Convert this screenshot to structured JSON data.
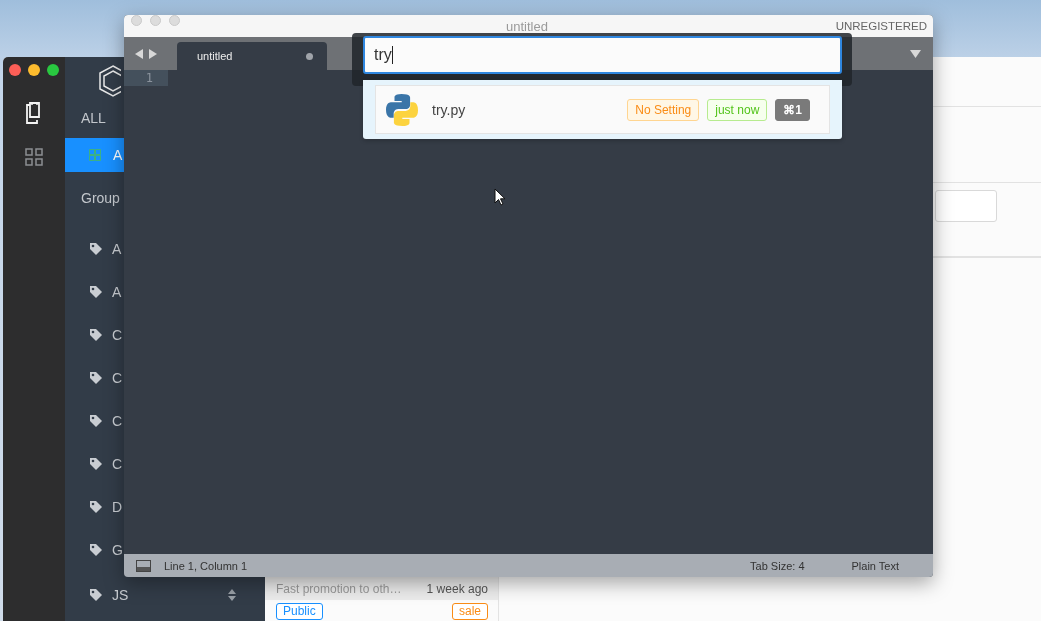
{
  "snippet_app": {
    "rail": [
      {
        "kind": "documents",
        "selected": true
      },
      {
        "kind": "grid",
        "selected": false
      }
    ],
    "sidebar": {
      "heading": "ALL",
      "all_item": {
        "label": "A",
        "selected": true
      },
      "group_heading": "Group",
      "tags": [
        {
          "label": "A"
        },
        {
          "label": "A"
        },
        {
          "label": "C"
        },
        {
          "label": "C"
        },
        {
          "label": "C"
        },
        {
          "label": "C"
        },
        {
          "label": "D"
        },
        {
          "label": "G"
        },
        {
          "label": "JS",
          "sortable": true
        }
      ]
    },
    "snippet": {
      "title": "Fast promotion to oth…",
      "time": "1 week ago",
      "tags": [
        {
          "label": "Public",
          "color": "#1890ff"
        },
        {
          "label": "sale",
          "color": "#fa8c16"
        }
      ]
    }
  },
  "editor": {
    "title": "untitled",
    "registration": "UNREGISTERED",
    "tabs": [
      {
        "label": "untitled",
        "modified": true,
        "selected": true
      }
    ],
    "line_numbers": [
      "1"
    ],
    "status_bar": {
      "position": "Line 1, Column 1",
      "tab_size": "Tab Size: 4",
      "syntax": "Plain Text"
    }
  },
  "palette": {
    "query": "try",
    "results": [
      {
        "name": "try.py",
        "selected": true,
        "badges": [
          {
            "label": "No Setting",
            "kind": "warning"
          },
          {
            "label": "just now",
            "kind": "success"
          },
          {
            "label": "⌘1",
            "kind": "shortcut"
          }
        ]
      }
    ]
  }
}
